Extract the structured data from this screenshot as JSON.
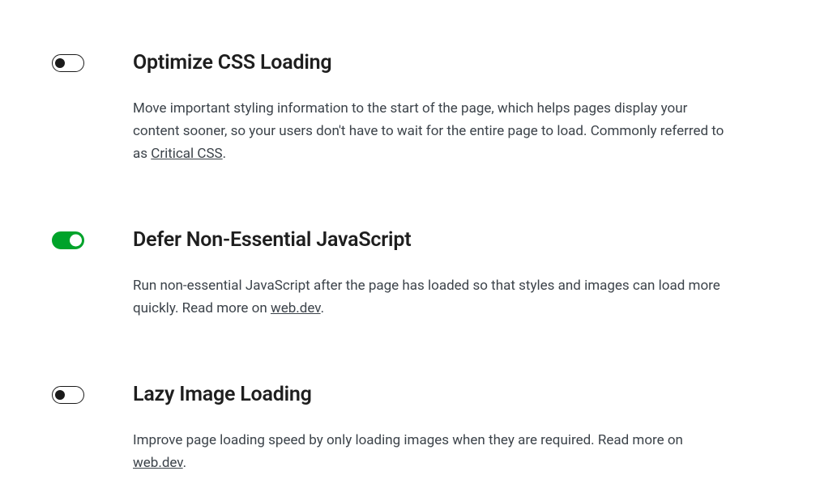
{
  "settings": [
    {
      "id": "optimize-css",
      "enabled": false,
      "title": "Optimize CSS Loading",
      "desc_before": "Move important styling information to the start of the page, which helps pages display your content sooner, so your users don't have to wait for the entire page to load. Commonly referred to as ",
      "link_text": "Critical CSS",
      "desc_after": "."
    },
    {
      "id": "defer-js",
      "enabled": true,
      "title": "Defer Non-Essential JavaScript",
      "desc_before": "Run non-essential JavaScript after the page has loaded so that styles and images can load more quickly. Read more on ",
      "link_text": "web.dev",
      "desc_after": "."
    },
    {
      "id": "lazy-images",
      "enabled": false,
      "title": "Lazy Image Loading",
      "desc_before": "Improve page loading speed by only loading images when they are required. Read more on ",
      "link_text": "web.dev",
      "desc_after": "."
    }
  ]
}
